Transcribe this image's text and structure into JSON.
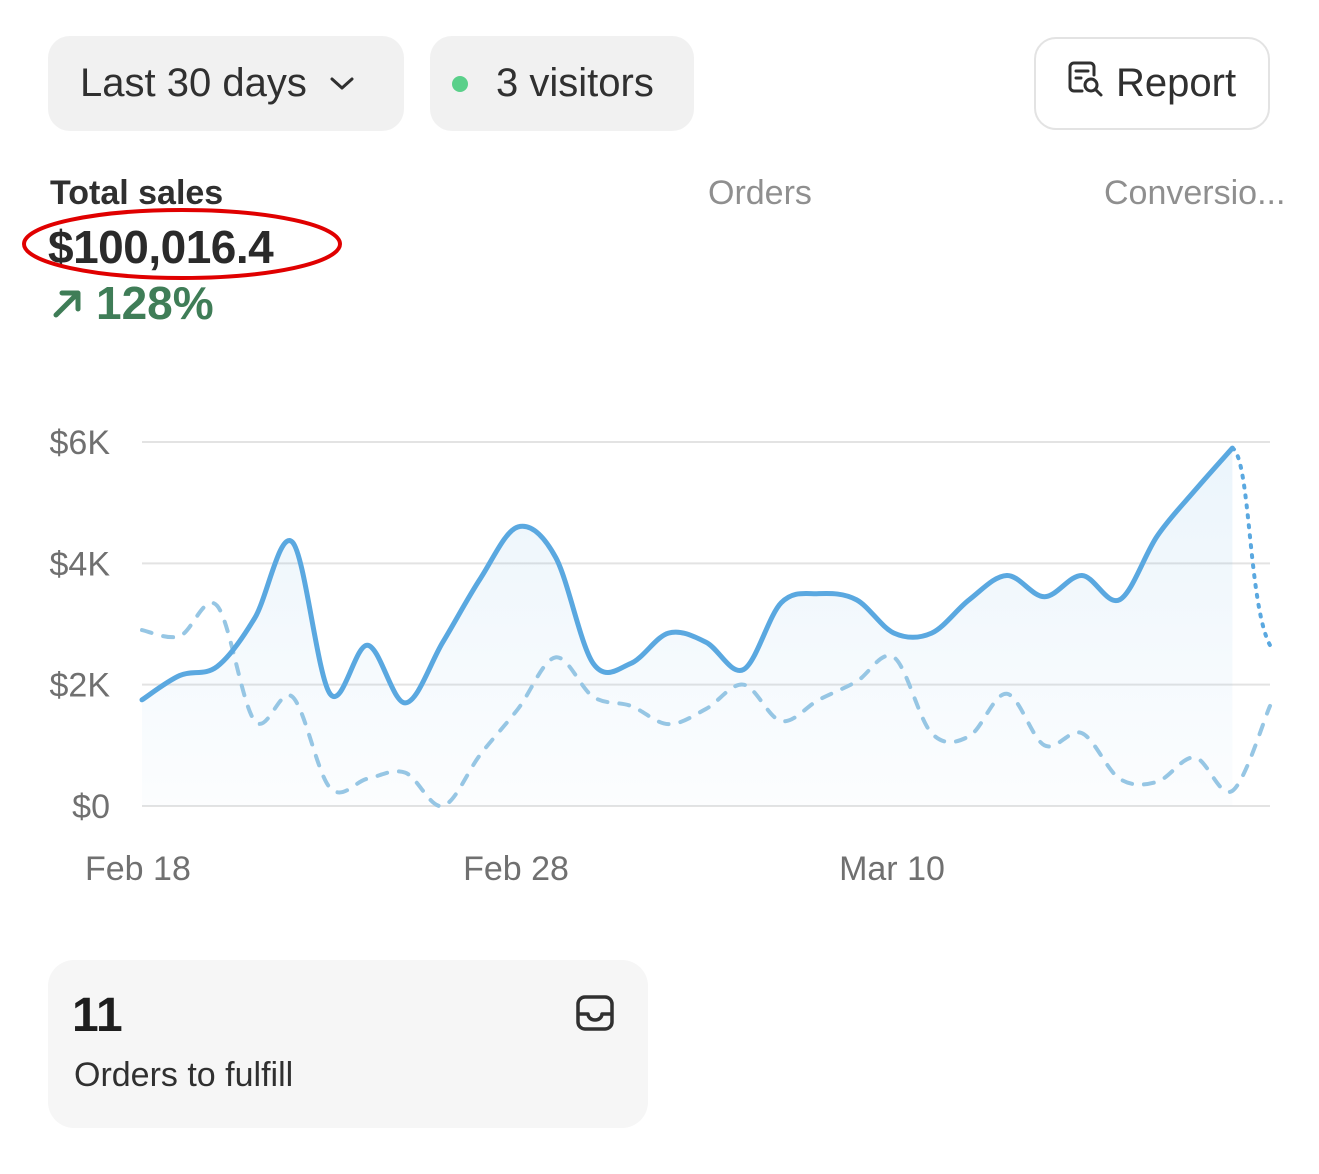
{
  "toolbar": {
    "date_range": "Last 30 days",
    "visitors": "3 visitors",
    "report_label": "Report",
    "live_dot_color": "#5ad08a"
  },
  "metrics": {
    "tabs": [
      "Total sales",
      "Orders",
      "Conversio..."
    ],
    "active_tab": "Total sales",
    "total_sales_value": "$100,016.4",
    "change_percent": "128%",
    "change_direction": "up",
    "change_color": "#3f7d57",
    "highlight_color": "#e00000"
  },
  "chart_data": {
    "type": "line",
    "y_ticks": [
      "$6K",
      "$4K",
      "$2K",
      "$0"
    ],
    "y_tick_values": [
      6000,
      4000,
      2000,
      0
    ],
    "x_tick_labels": [
      "Feb 18",
      "Feb 28",
      "Mar 10"
    ],
    "ylim": [
      0,
      6000
    ],
    "grid": true,
    "series": [
      {
        "style": "solid",
        "color": "#5aa8e0",
        "values": [
          1750,
          2150,
          2300,
          3100,
          4350,
          1850,
          2650,
          1700,
          2700,
          3750,
          4600,
          4100,
          2350,
          2350,
          2850,
          2700,
          2250,
          3350,
          3500,
          3400,
          2850,
          2850,
          3400,
          3800,
          3450,
          3800,
          3400,
          4450,
          5200,
          5900
        ],
        "projected_tail": [
          5900,
          2650
        ]
      },
      {
        "style": "dashed",
        "color": "#96c6e4",
        "values": [
          2900,
          2800,
          3300,
          1400,
          1800,
          300,
          450,
          550,
          0,
          850,
          1600,
          2450,
          1800,
          1650,
          1350,
          1600,
          2000,
          1400,
          1750,
          2050,
          2450,
          1200,
          1150,
          1850,
          1000,
          1200,
          450,
          400,
          800,
          250,
          1650
        ]
      }
    ]
  },
  "card": {
    "count": "11",
    "label": "Orders to fulfill",
    "icon": "inbox-icon"
  }
}
